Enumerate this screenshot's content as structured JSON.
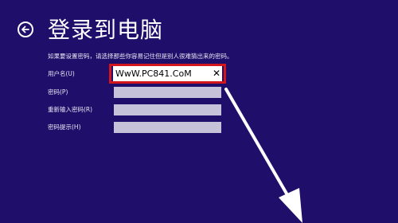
{
  "page": {
    "title": "登录到电脑",
    "instruction": "如果要设置密码，请选择那些你容易记住但是别人很难猜出来的密码。"
  },
  "icons": {
    "back": "back-arrow-circle-icon",
    "clear": "clear-x-icon",
    "annotation": "annotation-arrow"
  },
  "form": {
    "username_label": "用户名(U)",
    "username_value": "WwW.PC841.CoM",
    "password_label": "密码(P)",
    "password_value": "",
    "confirm_label": "重新输入密码(R)",
    "confirm_value": "",
    "hint_label": "密码提示(H)",
    "hint_value": "",
    "clear_glyph": "✕"
  },
  "colors": {
    "background": "#1f0f6b",
    "highlight": "#d2161b",
    "annotation": "#ffffff",
    "field": "#c5c2d9"
  }
}
